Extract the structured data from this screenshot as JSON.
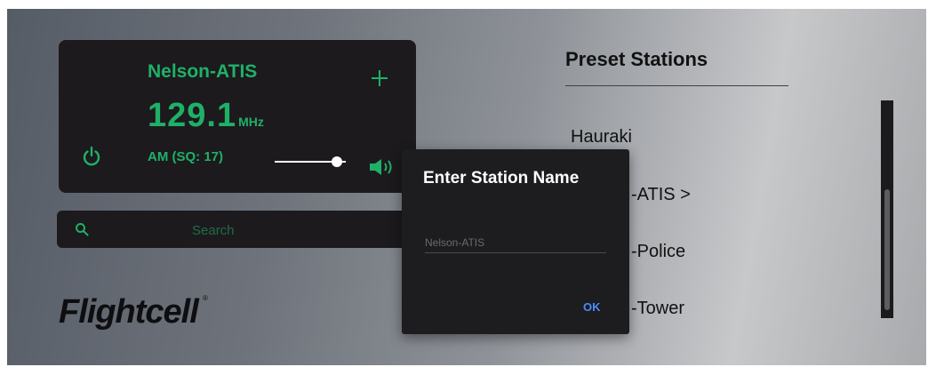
{
  "radio": {
    "station_name": "Nelson-ATIS",
    "frequency": "129.1",
    "frequency_unit": "MHz",
    "mode": "AM (SQ: 17)",
    "volume_level": 0.88,
    "icons": {
      "add": "plus-icon",
      "power": "power-icon",
      "speaker": "speaker-icon"
    },
    "accent_color": "#1fb068"
  },
  "search": {
    "placeholder": "Search",
    "icon": "search-icon"
  },
  "logo": {
    "text": "Flightcell",
    "registered": "®"
  },
  "presets": {
    "title": "Preset Stations",
    "items": [
      "Hauraki",
      "-ATIS >",
      "-Police",
      "-Tower"
    ]
  },
  "dialog": {
    "title": "Enter Station Name",
    "input_placeholder": "Nelson-ATIS",
    "input_value": "",
    "ok_label": "OK",
    "accent_color": "#4a8cff"
  }
}
